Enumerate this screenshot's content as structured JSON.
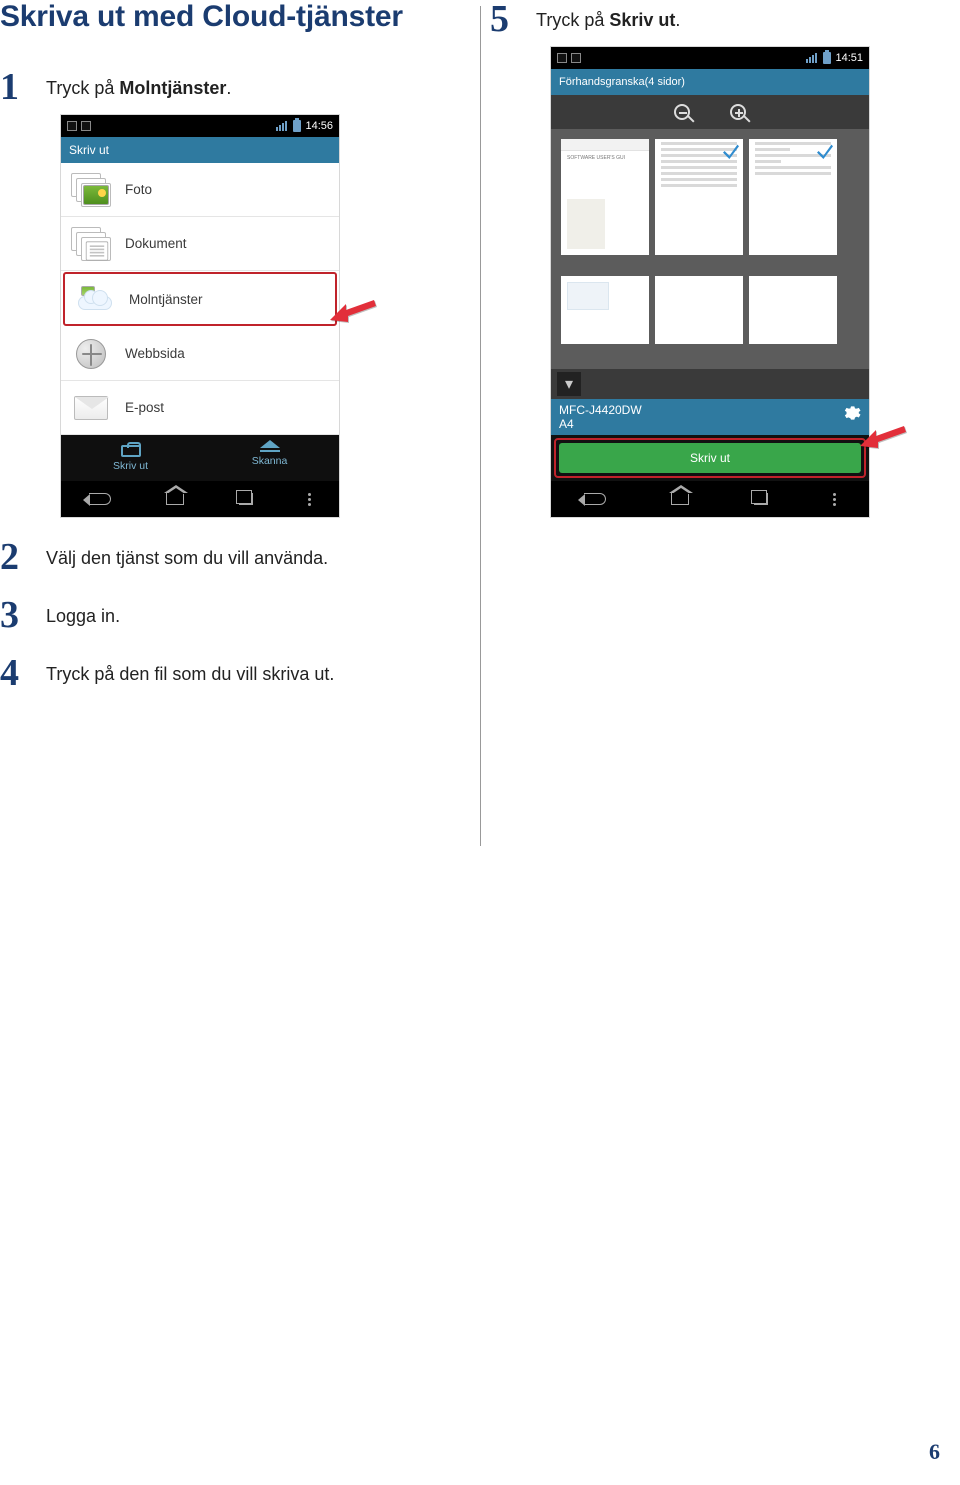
{
  "page_number": "6",
  "left": {
    "section_title": "Skriva ut med Cloud-tjänster",
    "steps": {
      "1": {
        "num": "1",
        "prefix": "Tryck på ",
        "bold": "Molntjänster",
        "suffix": "."
      },
      "2": {
        "num": "2",
        "text": "Välj den tjänst som du vill använda."
      },
      "3": {
        "num": "3",
        "text": "Logga in."
      },
      "4": {
        "num": "4",
        "text": "Tryck på den fil som du vill skriva ut."
      }
    },
    "shot": {
      "time": "14:56",
      "appbar": "Skriv ut",
      "items": {
        "foto": "Foto",
        "dokument": "Dokument",
        "molntjanster": "Molntjänster",
        "webbsida": "Webbsida",
        "epost": "E-post"
      },
      "tabs": {
        "print": "Skriv ut",
        "scan": "Skanna"
      }
    }
  },
  "right": {
    "steps": {
      "5": {
        "num": "5",
        "prefix": "Tryck på ",
        "bold": "Skriv ut",
        "suffix": "."
      }
    },
    "shot": {
      "time": "14:51",
      "appbar": "Förhandsgranska(4 sidor)",
      "printer_model": "MFC-J4420DW",
      "paper": "A4",
      "button": "Skriv ut",
      "thumb_caption": "SOFTWARE USER'S GUI"
    }
  }
}
